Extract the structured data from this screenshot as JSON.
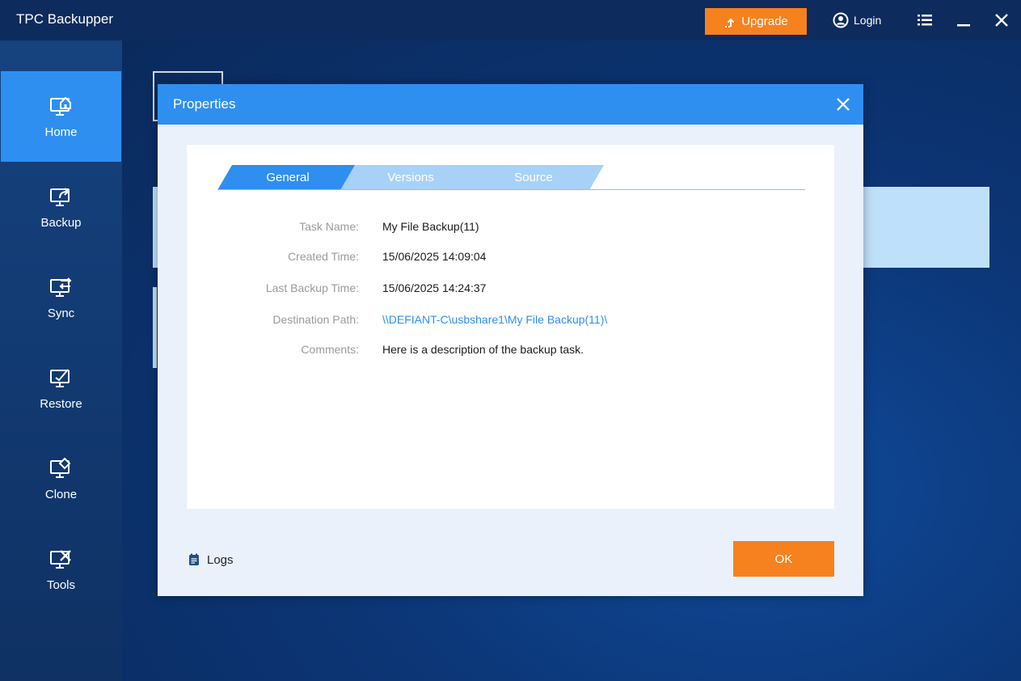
{
  "app": {
    "title": "TPC Backupper",
    "upgrade_label": "Upgrade",
    "login_label": "Login"
  },
  "sidebar": {
    "items": [
      {
        "label": "Home",
        "icon": "home-icon",
        "active": true
      },
      {
        "label": "Backup",
        "icon": "backup-icon",
        "active": false
      },
      {
        "label": "Sync",
        "icon": "sync-icon",
        "active": false
      },
      {
        "label": "Restore",
        "icon": "restore-icon",
        "active": false
      },
      {
        "label": "Clone",
        "icon": "clone-icon",
        "active": false
      },
      {
        "label": "Tools",
        "icon": "tools-icon",
        "active": false
      }
    ]
  },
  "dialog": {
    "title": "Properties",
    "tabs": [
      {
        "label": "General",
        "active": true
      },
      {
        "label": "Versions",
        "active": false
      },
      {
        "label": "Source",
        "active": false
      }
    ],
    "fields": [
      {
        "label": "Task Name:",
        "value": "My File Backup(11)"
      },
      {
        "label": "Created Time:",
        "value": "15/06/2025 14:09:04"
      },
      {
        "label": "Last Backup Time:",
        "value": "15/06/2025 14:24:37"
      },
      {
        "label": "Destination Path:",
        "value": "\\\\DEFIANT-C\\usbshare1\\My File Backup(11)\\"
      },
      {
        "label": "Comments:",
        "value": "Here is a description of the backup task."
      }
    ],
    "logs_label": "Logs",
    "ok_label": "OK"
  },
  "colors": {
    "accent": "#2e8ff0",
    "orange": "#f6811f",
    "titlebar": "#0d2b5c",
    "link": "#2e8ff0"
  }
}
